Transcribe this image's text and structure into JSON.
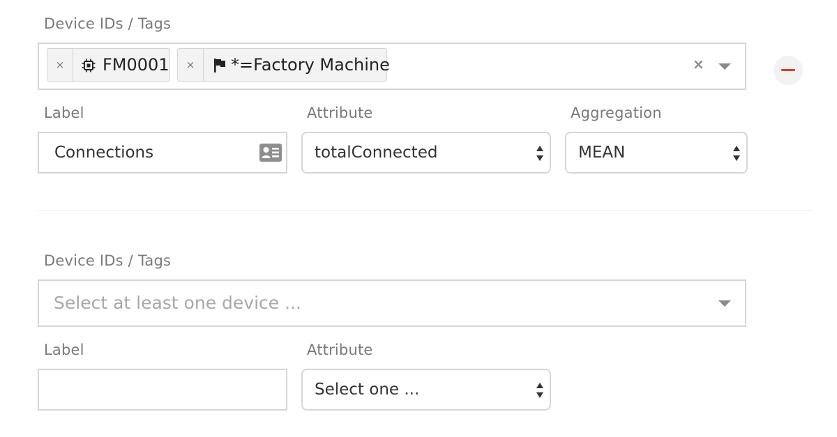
{
  "group1": {
    "devices_label": "Device IDs / Tags",
    "chips": [
      {
        "icon": "chip-icon",
        "text": "FM0001"
      },
      {
        "icon": "flag-icon",
        "text": "*=Factory Machine"
      }
    ],
    "chip_remove_glyph": "×",
    "clear_glyph": "×",
    "label_label": "Label",
    "label_value": "Connections",
    "attribute_label": "Attribute",
    "attribute_value": "totalConnected",
    "aggregation_label": "Aggregation",
    "aggregation_value": "MEAN",
    "colors": {
      "remove": "#e3392b",
      "border": "#d6d6d6",
      "label": "#7a7a7a"
    }
  },
  "group2": {
    "devices_label": "Device IDs / Tags",
    "devices_placeholder": "Select at least one device ...",
    "label_label": "Label",
    "label_value": "",
    "attribute_label": "Attribute",
    "attribute_value": "Select one ..."
  }
}
